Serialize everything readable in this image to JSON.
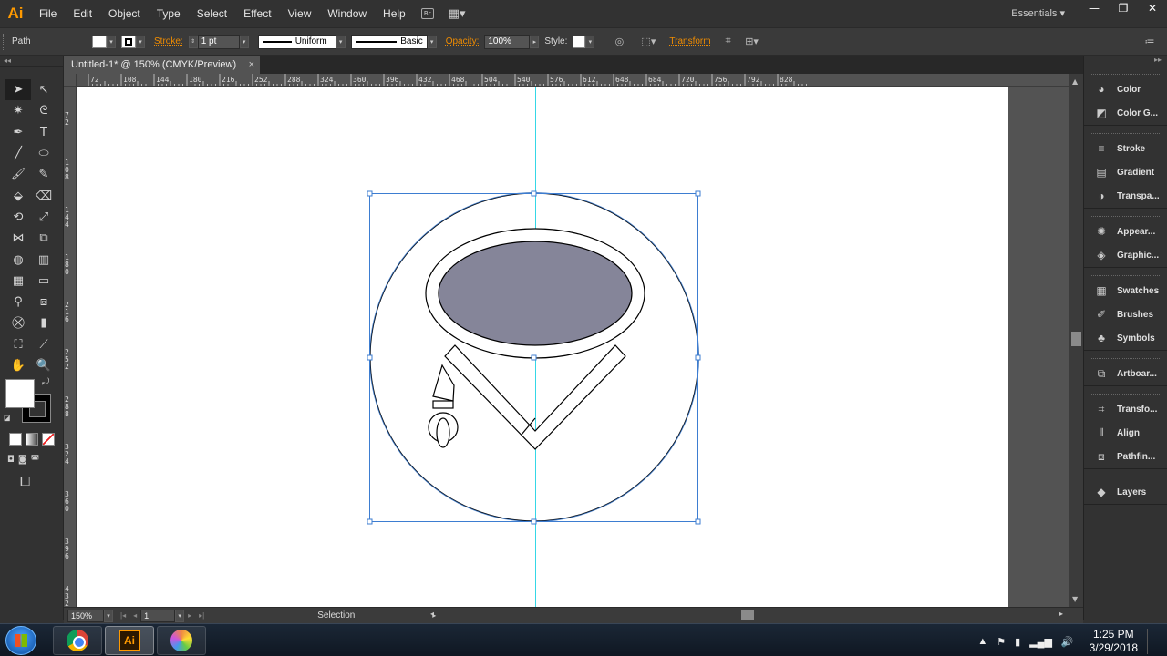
{
  "app": {
    "logo": "Ai"
  },
  "menu": [
    "File",
    "Edit",
    "Object",
    "Type",
    "Select",
    "Effect",
    "View",
    "Window",
    "Help"
  ],
  "menu_extras": {
    "bridge": "Br",
    "arrange": "▦▾"
  },
  "workspace": "Essentials ▾",
  "window_controls": [
    "—",
    "❐",
    "✕"
  ],
  "control_bar": {
    "selection_type": "Path",
    "stroke_label": "Stroke:",
    "stroke_weight": "1 pt",
    "stroke_profile": "Uniform",
    "brush": "Basic",
    "opacity_label": "Opacity:",
    "opacity": "100%",
    "style_label": "Style:",
    "transform_label": "Transform"
  },
  "document": {
    "tab_title": "Untitled-1* @ 150% (CMYK/Preview)",
    "close": "×"
  },
  "ruler": {
    "h_labels": [
      "72",
      "108",
      "144",
      "180",
      "216",
      "252",
      "288",
      "324",
      "360",
      "396",
      "432",
      "468",
      "504",
      "540",
      "576",
      "612",
      "648",
      "684",
      "720",
      "756",
      "792",
      "828"
    ],
    "v_labels": [
      "7 2",
      "1 0 8",
      "1 4 4",
      "1 8 0",
      "2 1 6",
      "2 5 2",
      "2 8 8",
      "3 2 4",
      "3 6 0",
      "3 9 6",
      "4 3 2"
    ]
  },
  "status_bar": {
    "zoom": "150%",
    "page": "1",
    "tool": "Selection"
  },
  "panels": [
    {
      "group": [
        {
          "name": "Color",
          "icon": "palette-icon"
        },
        {
          "name": "Color G...",
          "icon": "color-guide-icon"
        }
      ]
    },
    {
      "group": [
        {
          "name": "Stroke",
          "icon": "stroke-icon"
        },
        {
          "name": "Gradient",
          "icon": "gradient-icon"
        },
        {
          "name": "Transpa...",
          "icon": "transparency-icon"
        }
      ]
    },
    {
      "group": [
        {
          "name": "Appear...",
          "icon": "appearance-icon"
        },
        {
          "name": "Graphic...",
          "icon": "graphic-styles-icon"
        }
      ]
    },
    {
      "group": [
        {
          "name": "Swatches",
          "icon": "swatches-icon"
        },
        {
          "name": "Brushes",
          "icon": "brushes-icon"
        },
        {
          "name": "Symbols",
          "icon": "symbols-icon"
        }
      ]
    },
    {
      "group": [
        {
          "name": "Artboar...",
          "icon": "artboards-icon"
        }
      ]
    },
    {
      "group": [
        {
          "name": "Transfo...",
          "icon": "transform-icon"
        },
        {
          "name": "Align",
          "icon": "align-icon"
        },
        {
          "name": "Pathfin...",
          "icon": "pathfinder-icon"
        }
      ]
    },
    {
      "group": [
        {
          "name": "Layers",
          "icon": "layers-icon"
        }
      ]
    }
  ],
  "artwork": {
    "ellipse_fill": "#858599",
    "guide_color": "#35d7e6",
    "selection_color": "#3d7dd1"
  },
  "taskbar": {
    "time": "1:25 PM",
    "date": "3/29/2018",
    "ai_label": "Ai"
  }
}
